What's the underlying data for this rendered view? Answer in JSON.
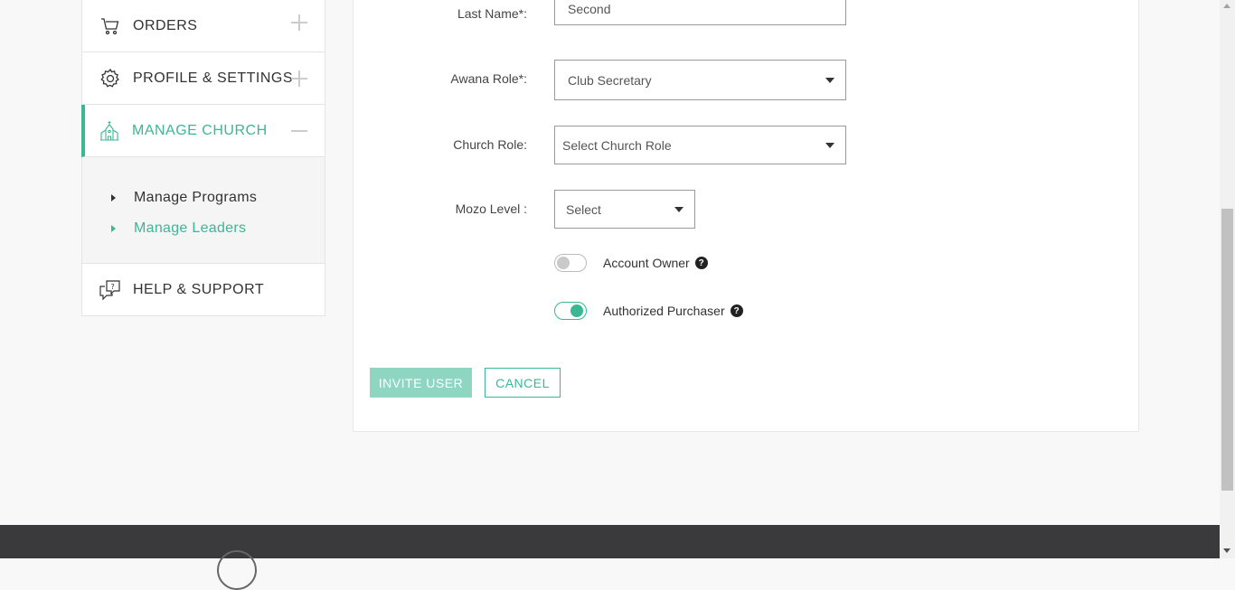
{
  "sidebar": {
    "items": [
      {
        "label": "ORDERS",
        "icon": "cart-icon"
      },
      {
        "label": "PROFILE & SETTINGS",
        "icon": "gear-icon"
      },
      {
        "label": "MANAGE CHURCH",
        "icon": "church-icon"
      },
      {
        "label": "HELP & SUPPORT",
        "icon": "help-chat-icon"
      }
    ],
    "submenu": [
      {
        "label": "Manage Programs"
      },
      {
        "label": "Manage Leaders"
      }
    ]
  },
  "form": {
    "last_name": {
      "label": "Last Name*:",
      "value": "Second"
    },
    "awana_role": {
      "label": "Awana Role*:",
      "value": "Club Secretary"
    },
    "church_role": {
      "label": "Church Role:",
      "value": "Select Church Role"
    },
    "mozo_level": {
      "label": "Mozo Level :",
      "value": "Select"
    },
    "account_owner": {
      "label": "Account Owner",
      "on": false
    },
    "authorized_purchaser": {
      "label": "Authorized Purchaser",
      "on": true
    },
    "help_glyph": "?"
  },
  "actions": {
    "invite_label": "INVITE USER",
    "cancel_label": "CANCEL"
  },
  "colors": {
    "accent": "#3ab795",
    "accent_light": "#8fd6c2",
    "footer": "#3a3a3d"
  }
}
